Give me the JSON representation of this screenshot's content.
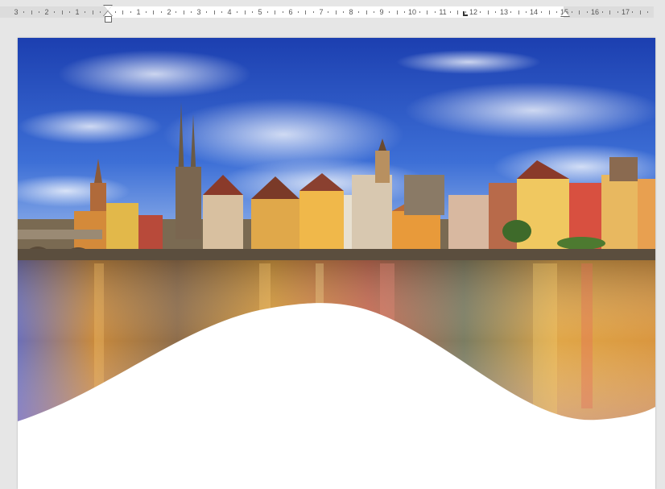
{
  "ruler": {
    "left_numbers": [
      "3",
      "2",
      "1"
    ],
    "right_numbers": [
      "1",
      "2",
      "3",
      "4",
      "5",
      "6",
      "7",
      "8",
      "9",
      "10",
      "11",
      "12",
      "13",
      "14",
      "15",
      "16",
      "17"
    ]
  },
  "document": {
    "image": {
      "subject": "city-waterfront-photo",
      "sky_color": "#2a56c8",
      "water_color": "#c08a3a",
      "wave_shape_color": "#ffffff"
    }
  }
}
